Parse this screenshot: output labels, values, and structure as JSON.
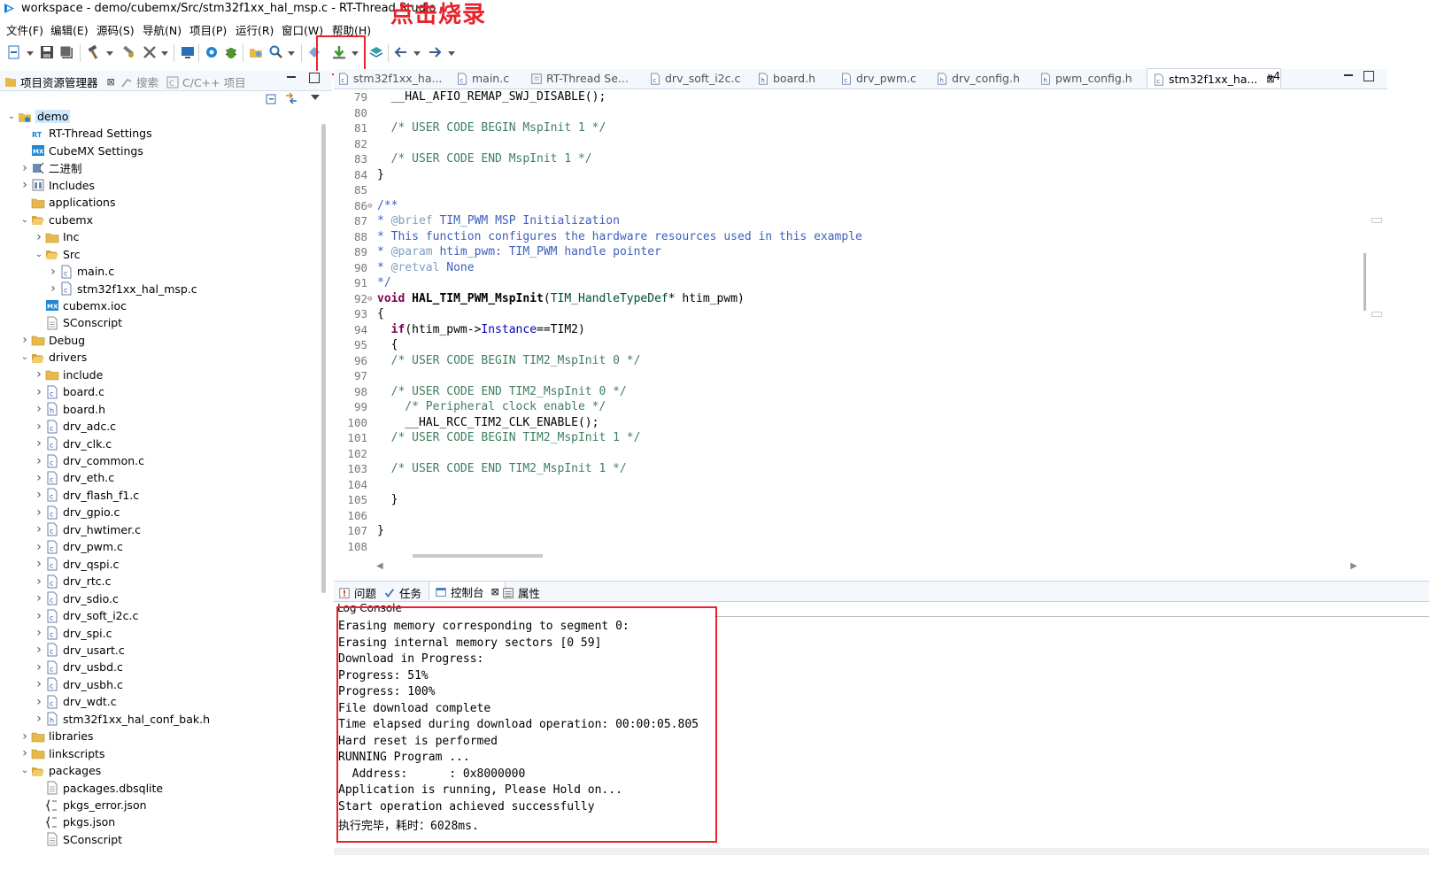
{
  "window": {
    "title": "workspace - demo/cubemx/Src/stm32f1xx_hal_msp.c - RT-Thread Studio"
  },
  "annotation": {
    "text": "点击烧录"
  },
  "menu": [
    "文件(F)",
    "编辑(E)",
    "源码(S)",
    "导航(N)",
    "项目(P)",
    "运行(R)",
    "窗口(W)",
    "帮助(H)"
  ],
  "left_tabs": {
    "project_explorer": "项目资源管理器",
    "search": "搜索",
    "cpp_projects": "C/C++ 项目"
  },
  "tree": [
    {
      "label": "demo",
      "indent": 0,
      "chev": "v",
      "icon": "project-icon",
      "selected": true
    },
    {
      "label": "RT-Thread Settings",
      "indent": 1,
      "chev": "",
      "icon": "rt-settings-icon"
    },
    {
      "label": "CubeMX Settings",
      "indent": 1,
      "chev": "",
      "icon": "mx-settings-icon"
    },
    {
      "label": "二进制",
      "indent": 1,
      "chev": ">",
      "icon": "binary-icon"
    },
    {
      "label": "Includes",
      "indent": 1,
      "chev": ">",
      "icon": "includes-icon"
    },
    {
      "label": "applications",
      "indent": 1,
      "chev": "",
      "icon": "folder-icon"
    },
    {
      "label": "cubemx",
      "indent": 1,
      "chev": "v",
      "icon": "folder-open-icon"
    },
    {
      "label": "Inc",
      "indent": 2,
      "chev": ">",
      "icon": "folder-icon"
    },
    {
      "label": "Src",
      "indent": 2,
      "chev": "v",
      "icon": "folder-open-icon"
    },
    {
      "label": "main.c",
      "indent": 3,
      "chev": ">",
      "icon": "c-file-icon"
    },
    {
      "label": "stm32f1xx_hal_msp.c",
      "indent": 3,
      "chev": ">",
      "icon": "c-file-icon"
    },
    {
      "label": "cubemx.ioc",
      "indent": 2,
      "chev": "",
      "icon": "mx-file-icon"
    },
    {
      "label": "SConscript",
      "indent": 2,
      "chev": "",
      "icon": "text-file-icon"
    },
    {
      "label": "Debug",
      "indent": 1,
      "chev": ">",
      "icon": "folder-icon"
    },
    {
      "label": "drivers",
      "indent": 1,
      "chev": "v",
      "icon": "folder-open-icon"
    },
    {
      "label": "include",
      "indent": 2,
      "chev": ">",
      "icon": "folder-icon"
    },
    {
      "label": "board.c",
      "indent": 2,
      "chev": ">",
      "icon": "c-file-icon"
    },
    {
      "label": "board.h",
      "indent": 2,
      "chev": ">",
      "icon": "h-file-icon"
    },
    {
      "label": "drv_adc.c",
      "indent": 2,
      "chev": ">",
      "icon": "c-file-icon"
    },
    {
      "label": "drv_clk.c",
      "indent": 2,
      "chev": ">",
      "icon": "c-file-icon"
    },
    {
      "label": "drv_common.c",
      "indent": 2,
      "chev": ">",
      "icon": "c-file-icon"
    },
    {
      "label": "drv_eth.c",
      "indent": 2,
      "chev": ">",
      "icon": "c-file-icon"
    },
    {
      "label": "drv_flash_f1.c",
      "indent": 2,
      "chev": ">",
      "icon": "c-file-icon"
    },
    {
      "label": "drv_gpio.c",
      "indent": 2,
      "chev": ">",
      "icon": "c-file-icon"
    },
    {
      "label": "drv_hwtimer.c",
      "indent": 2,
      "chev": ">",
      "icon": "c-file-icon"
    },
    {
      "label": "drv_pwm.c",
      "indent": 2,
      "chev": ">",
      "icon": "c-file-icon"
    },
    {
      "label": "drv_qspi.c",
      "indent": 2,
      "chev": ">",
      "icon": "c-file-icon"
    },
    {
      "label": "drv_rtc.c",
      "indent": 2,
      "chev": ">",
      "icon": "c-file-icon"
    },
    {
      "label": "drv_sdio.c",
      "indent": 2,
      "chev": ">",
      "icon": "c-file-icon"
    },
    {
      "label": "drv_soft_i2c.c",
      "indent": 2,
      "chev": ">",
      "icon": "c-file-icon"
    },
    {
      "label": "drv_spi.c",
      "indent": 2,
      "chev": ">",
      "icon": "c-file-icon"
    },
    {
      "label": "drv_usart.c",
      "indent": 2,
      "chev": ">",
      "icon": "c-file-icon"
    },
    {
      "label": "drv_usbd.c",
      "indent": 2,
      "chev": ">",
      "icon": "c-file-icon"
    },
    {
      "label": "drv_usbh.c",
      "indent": 2,
      "chev": ">",
      "icon": "c-file-icon"
    },
    {
      "label": "drv_wdt.c",
      "indent": 2,
      "chev": ">",
      "icon": "c-file-icon"
    },
    {
      "label": "stm32f1xx_hal_conf_bak.h",
      "indent": 2,
      "chev": ">",
      "icon": "h-file-icon"
    },
    {
      "label": "libraries",
      "indent": 1,
      "chev": ">",
      "icon": "folder-icon"
    },
    {
      "label": "linkscripts",
      "indent": 1,
      "chev": ">",
      "icon": "folder-icon"
    },
    {
      "label": "packages",
      "indent": 1,
      "chev": "v",
      "icon": "folder-open-icon"
    },
    {
      "label": "packages.dbsqlite",
      "indent": 2,
      "chev": "",
      "icon": "text-file-icon"
    },
    {
      "label": "pkgs_error.json",
      "indent": 2,
      "chev": "",
      "icon": "json-file-icon"
    },
    {
      "label": "pkgs.json",
      "indent": 2,
      "chev": "",
      "icon": "json-file-icon"
    },
    {
      "label": "SConscript",
      "indent": 2,
      "chev": "",
      "icon": "text-file-icon"
    }
  ],
  "editor_tabs": [
    {
      "label": "stm32f1xx_ha...",
      "icon": "c-file-icon"
    },
    {
      "label": "main.c",
      "icon": "c-file-icon"
    },
    {
      "label": "RT-Thread Se...",
      "icon": "settings-tab-icon"
    },
    {
      "label": "drv_soft_i2c.c",
      "icon": "c-file-icon"
    },
    {
      "label": "board.h",
      "icon": "h-file-icon"
    },
    {
      "label": "drv_pwm.c",
      "icon": "c-file-icon"
    },
    {
      "label": "drv_config.h",
      "icon": "h-file-icon"
    },
    {
      "label": "pwm_config.h",
      "icon": "h-file-icon"
    },
    {
      "label": "stm32f1xx_ha...",
      "icon": "c-file-icon",
      "active": true
    }
  ],
  "editor_overflow": "»4",
  "code_lines": [
    {
      "n": "79",
      "segs": [
        [
          "",
          "  __HAL_AFIO_REMAP_SWJ_DISABLE();"
        ]
      ]
    },
    {
      "n": "80",
      "segs": []
    },
    {
      "n": "81",
      "segs": [
        [
          "cm",
          "  /* USER CODE BEGIN MspInit 1 */"
        ]
      ]
    },
    {
      "n": "82",
      "segs": []
    },
    {
      "n": "83",
      "segs": [
        [
          "cm",
          "  /* USER CODE END MspInit 1 */"
        ]
      ]
    },
    {
      "n": "84",
      "segs": [
        [
          "",
          "}"
        ]
      ]
    },
    {
      "n": "85",
      "segs": []
    },
    {
      "n": "86",
      "fold": true,
      "segs": [
        [
          "jd",
          "/**"
        ]
      ]
    },
    {
      "n": "87",
      "segs": [
        [
          "jd",
          "* "
        ],
        [
          "jt",
          "@brief"
        ],
        [
          "jd",
          " TIM_PWM MSP Initialization"
        ]
      ]
    },
    {
      "n": "88",
      "segs": [
        [
          "jd",
          "* This function configures the hardware resources used in this example"
        ]
      ]
    },
    {
      "n": "89",
      "segs": [
        [
          "jd",
          "* "
        ],
        [
          "jt",
          "@param"
        ],
        [
          "jd",
          " htim_pwm: TIM_PWM handle pointer"
        ]
      ]
    },
    {
      "n": "90",
      "segs": [
        [
          "jd",
          "* "
        ],
        [
          "jt",
          "@retval"
        ],
        [
          "jd",
          " None"
        ]
      ]
    },
    {
      "n": "91",
      "segs": [
        [
          "jd",
          "*/"
        ]
      ]
    },
    {
      "n": "92",
      "fold": true,
      "segs": [
        [
          "kw",
          "void"
        ],
        [
          "",
          " "
        ],
        [
          "fn",
          "HAL_TIM_PWM_MspInit"
        ],
        [
          "",
          "("
        ],
        [
          "ty",
          "TIM_HandleTypeDef"
        ],
        [
          "",
          "* htim_pwm)"
        ]
      ]
    },
    {
      "n": "93",
      "segs": [
        [
          "",
          "{"
        ]
      ]
    },
    {
      "n": "94",
      "segs": [
        [
          "",
          "  "
        ],
        [
          "kw",
          "if"
        ],
        [
          "",
          "(htim_pwm->"
        ],
        [
          "fld",
          "Instance"
        ],
        [
          "",
          "==TIM2)"
        ]
      ]
    },
    {
      "n": "95",
      "segs": [
        [
          "",
          "  {"
        ]
      ]
    },
    {
      "n": "96",
      "segs": [
        [
          "cm",
          "  /* USER CODE BEGIN TIM2_MspInit 0 */"
        ]
      ]
    },
    {
      "n": "97",
      "segs": []
    },
    {
      "n": "98",
      "segs": [
        [
          "cm",
          "  /* USER CODE END TIM2_MspInit 0 */"
        ]
      ]
    },
    {
      "n": "99",
      "segs": [
        [
          "cm",
          "    /* Peripheral clock enable */"
        ]
      ]
    },
    {
      "n": "100",
      "segs": [
        [
          "",
          "    __HAL_RCC_TIM2_CLK_ENABLE();"
        ]
      ]
    },
    {
      "n": "101",
      "segs": [
        [
          "cm",
          "  /* USER CODE BEGIN TIM2_MspInit 1 */"
        ]
      ]
    },
    {
      "n": "102",
      "segs": []
    },
    {
      "n": "103",
      "segs": [
        [
          "cm",
          "  /* USER CODE END TIM2_MspInit 1 */"
        ]
      ]
    },
    {
      "n": "104",
      "segs": []
    },
    {
      "n": "105",
      "segs": [
        [
          "",
          "  }"
        ]
      ]
    },
    {
      "n": "106",
      "segs": []
    },
    {
      "n": "107",
      "segs": [
        [
          "",
          "}"
        ]
      ]
    },
    {
      "n": "108",
      "segs": []
    }
  ],
  "console_tabs": [
    {
      "label": "问题",
      "icon": "problems-icon"
    },
    {
      "label": "任务",
      "icon": "tasks-icon"
    },
    {
      "label": "控制台",
      "icon": "console-icon",
      "active": true
    },
    {
      "label": "属性",
      "icon": "properties-icon"
    }
  ],
  "console": {
    "name": "Log Console",
    "lines": [
      "Erasing memory corresponding to segment 0:",
      "Erasing internal memory sectors [0 59]",
      "Download in Progress:",
      "Progress: 51%",
      "Progress: 100%",
      "File download complete",
      "Time elapsed during download operation: 00:00:05.805",
      "Hard reset is performed",
      "RUNNING Program ...",
      "  Address:      : 0x8000000",
      "Application is running, Please Hold on...",
      "Start operation achieved successfully",
      "执行完毕，耗时：6028ms."
    ]
  },
  "colors": {
    "accent_red": "#e8232a",
    "comment": "#3f7f5f",
    "javadoc": "#3f5fbf",
    "keyword": "#7f0055"
  }
}
